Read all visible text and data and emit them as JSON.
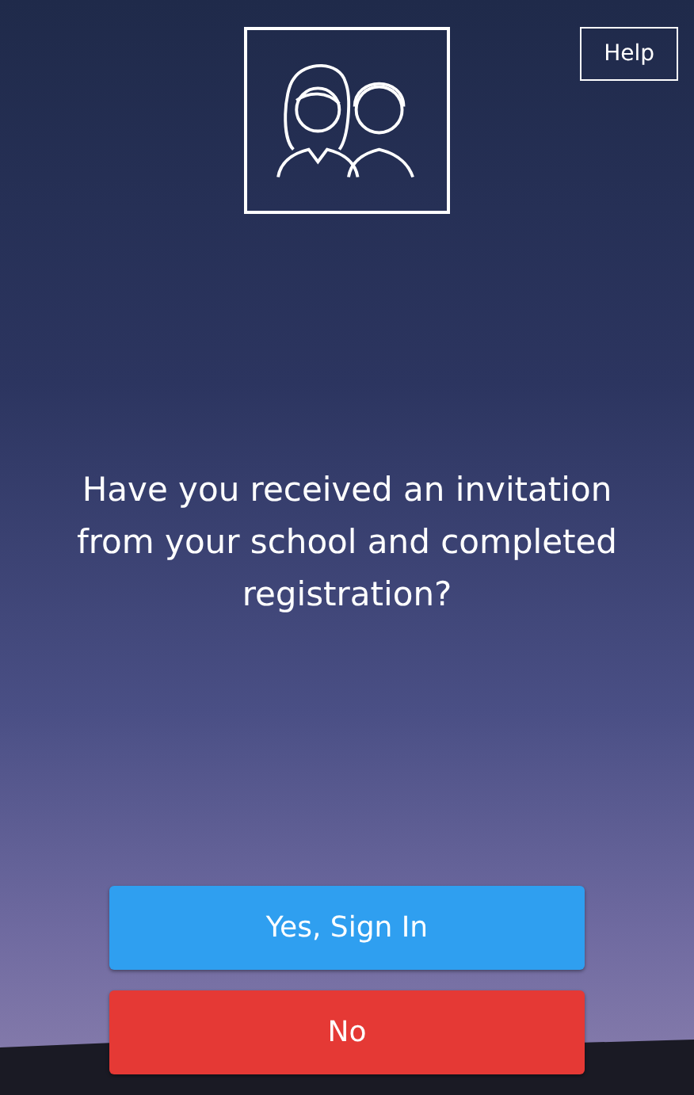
{
  "help_button": {
    "label": "Help"
  },
  "question": "Have you received an invitation from your school and completed registration?",
  "buttons": [
    {
      "label": "Yes, Sign In",
      "kind": "primary"
    },
    {
      "label": "No",
      "kind": "danger"
    }
  ]
}
